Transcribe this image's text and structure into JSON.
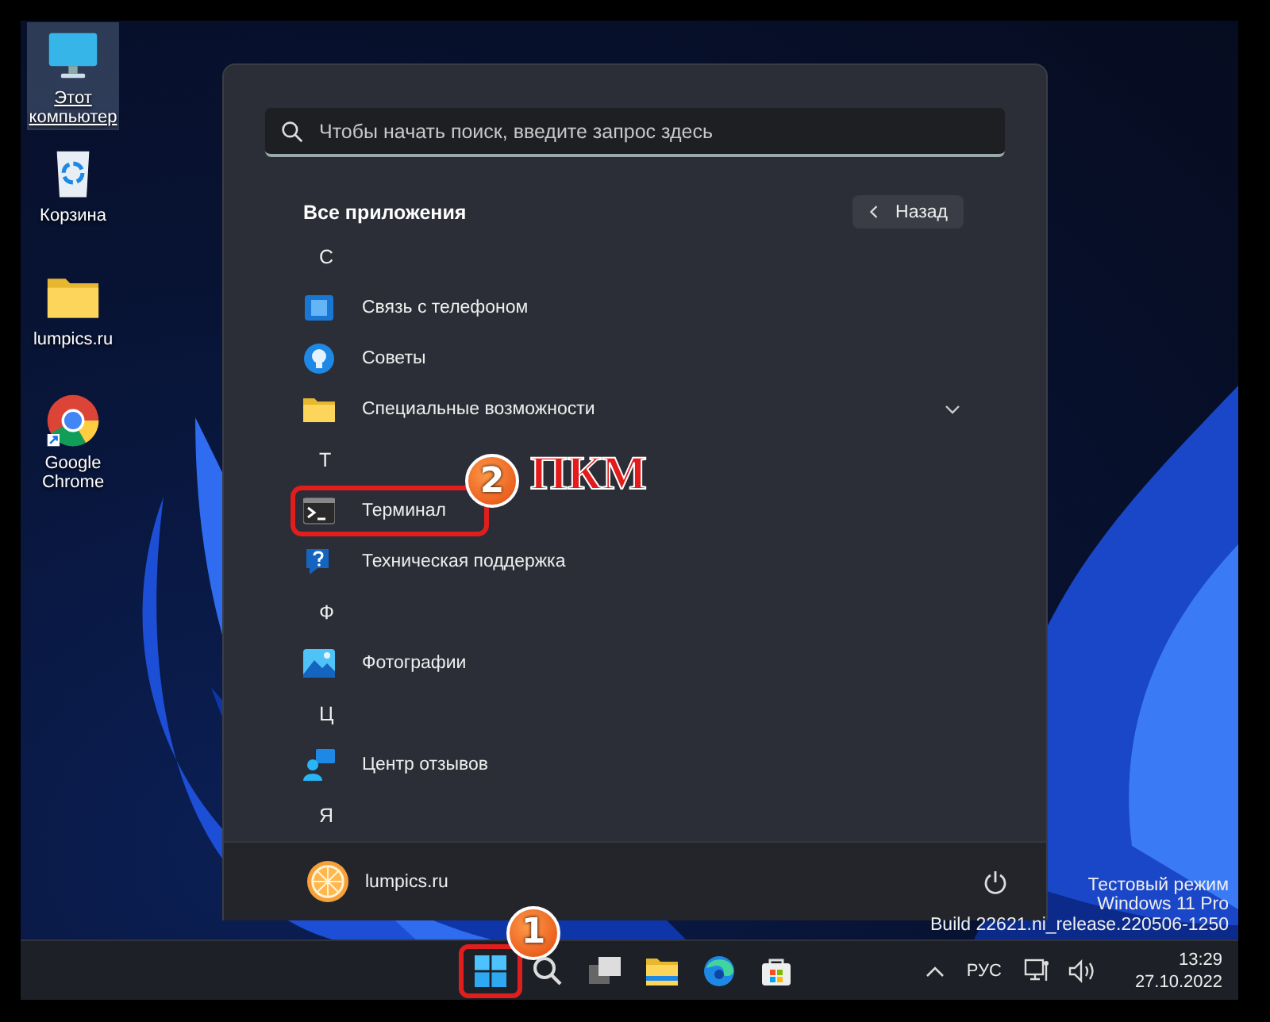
{
  "desktop_icons": [
    {
      "label": "Этот компьютер",
      "kind": "computer",
      "selected": true
    },
    {
      "label": "Корзина",
      "kind": "recycle",
      "selected": false
    },
    {
      "label": "lumpics.ru",
      "kind": "folder",
      "selected": false
    },
    {
      "label": "Google Chrome",
      "kind": "chrome",
      "selected": false
    }
  ],
  "start_menu": {
    "search": {
      "placeholder": "Чтобы начать поиск, введите запрос здесь"
    },
    "section_title": "Все приложения",
    "back_button": "Назад",
    "groups": [
      {
        "letter": "С",
        "apps": [
          {
            "name": "Связь с телефоном",
            "kind": "phone",
            "highlighted": false
          },
          {
            "name": "Советы",
            "kind": "tips",
            "highlighted": false
          },
          {
            "name": "Специальные возможности",
            "kind": "folder",
            "expanded": false,
            "highlighted": false
          }
        ]
      },
      {
        "letter": "Т",
        "apps": [
          {
            "name": "Терминал",
            "kind": "terminal",
            "highlighted": true,
            "marker": "2",
            "marker_label": "ПКМ"
          },
          {
            "name": "Техническая поддержка",
            "kind": "help",
            "highlighted": false
          }
        ]
      },
      {
        "letter": "Ф",
        "apps": [
          {
            "name": "Фотографии",
            "kind": "photos",
            "highlighted": false
          }
        ]
      },
      {
        "letter": "Ц",
        "apps": [
          {
            "name": "Центр отзывов",
            "kind": "feedback",
            "highlighted": false
          }
        ]
      },
      {
        "letter": "Я"
      }
    ],
    "user": {
      "name": "lumpics.ru"
    }
  },
  "system_notice": [
    "Тестовый режим",
    "Windows 11 Pro",
    "Build 22621.ni_release.220506-1250"
  ],
  "taskbar": {
    "icons": [
      {
        "kind": "start",
        "highlighted": true,
        "marker": "1"
      },
      {
        "kind": "search",
        "highlighted": false
      },
      {
        "kind": "taskview",
        "highlighted": false
      },
      {
        "kind": "explorer",
        "highlighted": false
      },
      {
        "kind": "edge",
        "highlighted": false
      },
      {
        "kind": "store",
        "highlighted": false
      }
    ],
    "language": "РУС",
    "time": "13:29",
    "date": "27.10.2022"
  }
}
